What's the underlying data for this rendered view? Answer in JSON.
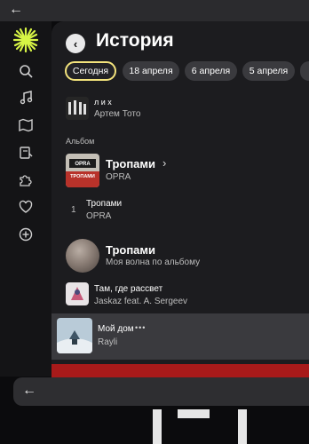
{
  "window": {
    "back_icon": "arrow-left-icon"
  },
  "sidebar": {
    "icons": [
      "search-icon",
      "music-note-icon",
      "map-icon",
      "book-icon",
      "puzzle-icon",
      "heart-icon",
      "plus-circle-icon"
    ]
  },
  "header": {
    "title": "История"
  },
  "tabs": [
    {
      "label": "Сегодня",
      "active": true
    },
    {
      "label": "18 апреля",
      "active": false
    },
    {
      "label": "6 апреля",
      "active": false
    },
    {
      "label": "5 апреля",
      "active": false
    }
  ],
  "items": {
    "top_track": {
      "title": "л и х",
      "artist": "Артем Тото"
    },
    "section_label": "Альбом",
    "album": {
      "title": "Тропами",
      "artist": "OPRA",
      "cover_text": "OPRA\nТРОПАМИ"
    },
    "album_track": {
      "number": "1",
      "title": "Тропами",
      "artist": "OPRA"
    },
    "wave": {
      "title": "Тропами",
      "subtitle": "Моя волна по альбому"
    },
    "track_dawn": {
      "title": "Там, где рассвет",
      "artist": "Jaskaz feat. A. Sergeev"
    },
    "track_home": {
      "title": "Мой дом",
      "artist": "Rayli",
      "more": "•••"
    }
  },
  "colors": {
    "accent": "#f3e37c",
    "player_red": "#a81a1a"
  }
}
